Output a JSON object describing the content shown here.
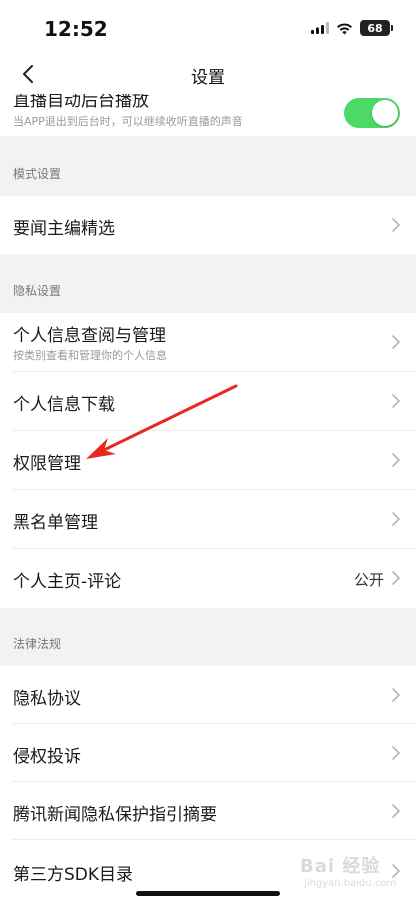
{
  "status": {
    "time": "12:52",
    "battery": "68"
  },
  "nav": {
    "title": "设置"
  },
  "top_row": {
    "label": "直播自动后台播放",
    "sub": "当APP退出到后台时，可以继续收听直播的声音",
    "toggle_on": true
  },
  "sections": [
    {
      "header": "模式设置",
      "items": [
        {
          "label": "要闻主编精选"
        }
      ]
    },
    {
      "header": "隐私设置",
      "items": [
        {
          "label": "个人信息查阅与管理",
          "sub": "按类别查看和管理你的个人信息"
        },
        {
          "label": "个人信息下载"
        },
        {
          "label": "权限管理"
        },
        {
          "label": "黑名单管理"
        },
        {
          "label": "个人主页-评论",
          "value": "公开"
        }
      ]
    },
    {
      "header": "法律法规",
      "items": [
        {
          "label": "隐私协议"
        },
        {
          "label": "侵权投诉"
        },
        {
          "label": "腾讯新闻隐私保护指引摘要"
        },
        {
          "label": "第三方SDK目录"
        }
      ]
    }
  ],
  "watermark": {
    "logo": "Bai 经验",
    "url": "jingyan.baidu.com"
  },
  "colors": {
    "toggle_on": "#4cd964",
    "annotation_arrow": "#e8281f"
  }
}
